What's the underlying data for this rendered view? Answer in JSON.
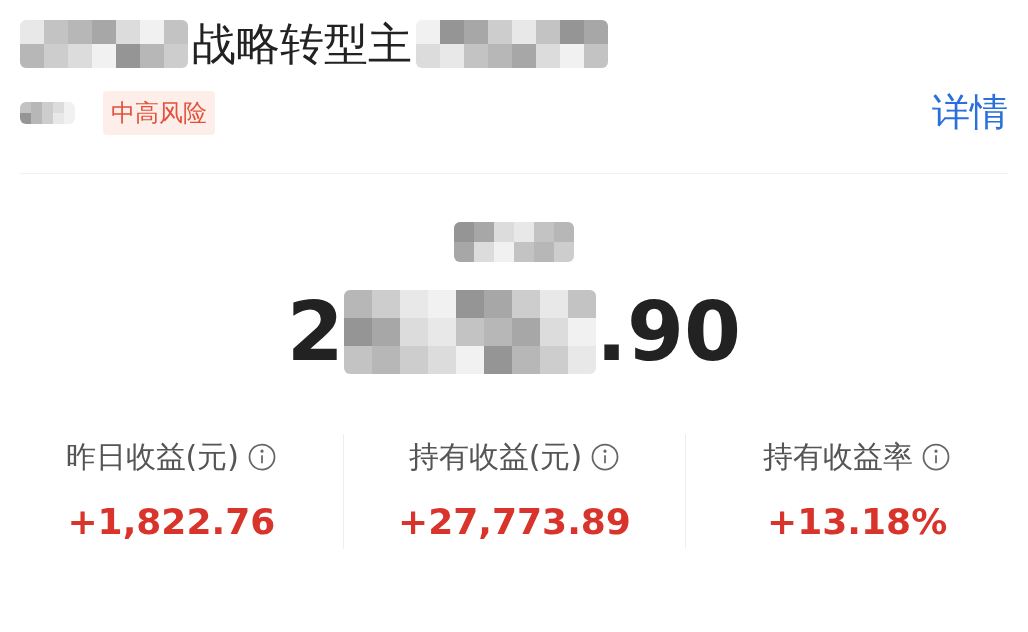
{
  "fund": {
    "title_visible": "战略转型主",
    "risk_badge": "中高风险",
    "detail_link": "详情"
  },
  "holding": {
    "amount_lead": "2",
    "amount_tail": ".90"
  },
  "stats": [
    {
      "label": "昨日收益(元)",
      "value": "+1,822.76"
    },
    {
      "label": "持有收益(元)",
      "value": "+27,773.89"
    },
    {
      "label": "持有收益率",
      "value": "+13.18%"
    }
  ]
}
